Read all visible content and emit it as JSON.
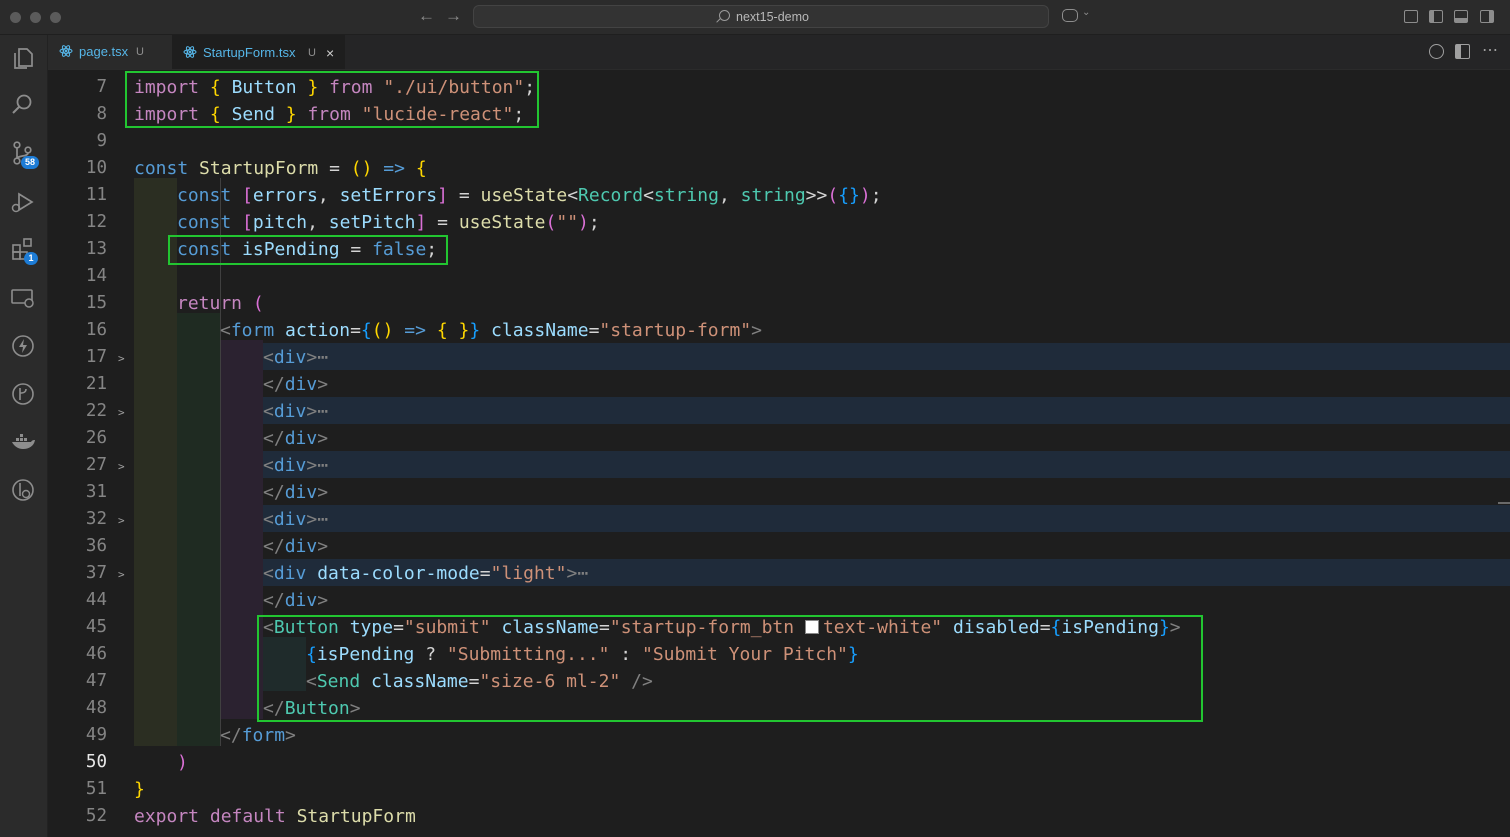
{
  "window": {
    "title": "next15-demo"
  },
  "tabs": [
    {
      "name": "page.tsx",
      "status": "U"
    },
    {
      "name": "StartupForm.tsx",
      "status": "U",
      "close": "×"
    }
  ],
  "activity": {
    "source_control_badge": "58",
    "extensions_badge": "1"
  },
  "code": {
    "active_line": "50",
    "lines": [
      {
        "n": "7"
      },
      {
        "n": "8"
      },
      {
        "n": "9"
      },
      {
        "n": "10"
      },
      {
        "n": "11"
      },
      {
        "n": "12"
      },
      {
        "n": "13"
      },
      {
        "n": "14"
      },
      {
        "n": "15"
      },
      {
        "n": "16"
      },
      {
        "n": "17"
      },
      {
        "n": "21"
      },
      {
        "n": "22"
      },
      {
        "n": "26"
      },
      {
        "n": "27"
      },
      {
        "n": "31"
      },
      {
        "n": "32"
      },
      {
        "n": "36"
      },
      {
        "n": "37"
      },
      {
        "n": "44"
      },
      {
        "n": "45"
      },
      {
        "n": "46"
      },
      {
        "n": "47"
      },
      {
        "n": "48"
      },
      {
        "n": "49"
      },
      {
        "n": "50"
      },
      {
        "n": "51"
      },
      {
        "n": "52"
      }
    ],
    "t": {
      "import": "import",
      "from": "from",
      "const": "const",
      "return": "return",
      "export": "export",
      "default": "default",
      "Button": "Button",
      "Send": "Send",
      "ui_button": "\"./ui/button\"",
      "lucide": "\"lucide-react\"",
      "StartupForm": "StartupForm",
      "arrow": "=>",
      "errors": "errors",
      "setErrors": "setErrors",
      "useState": "useState",
      "Record": "Record",
      "string": "string",
      "pitch": "pitch",
      "setPitch": "setPitch",
      "empty_str": "\"\"",
      "isPending": "isPending",
      "false": "false",
      "form": "form",
      "action": "action",
      "className": "className",
      "startup_form": "\"startup-form\"",
      "div": "div",
      "ellipsis": "⋯",
      "data_color_mode": "data-color-mode",
      "light": "\"light\"",
      "type": "type",
      "submit": "\"submit\"",
      "btn_class_a": "\"startup-form_btn ",
      "btn_class_b": "text-white\"",
      "disabled": "disabled",
      "submitting": "\"Submitting...\"",
      "submit_pitch": "\"Submit Your Pitch\"",
      "size_class": "\"size-6 ml-2\""
    }
  }
}
